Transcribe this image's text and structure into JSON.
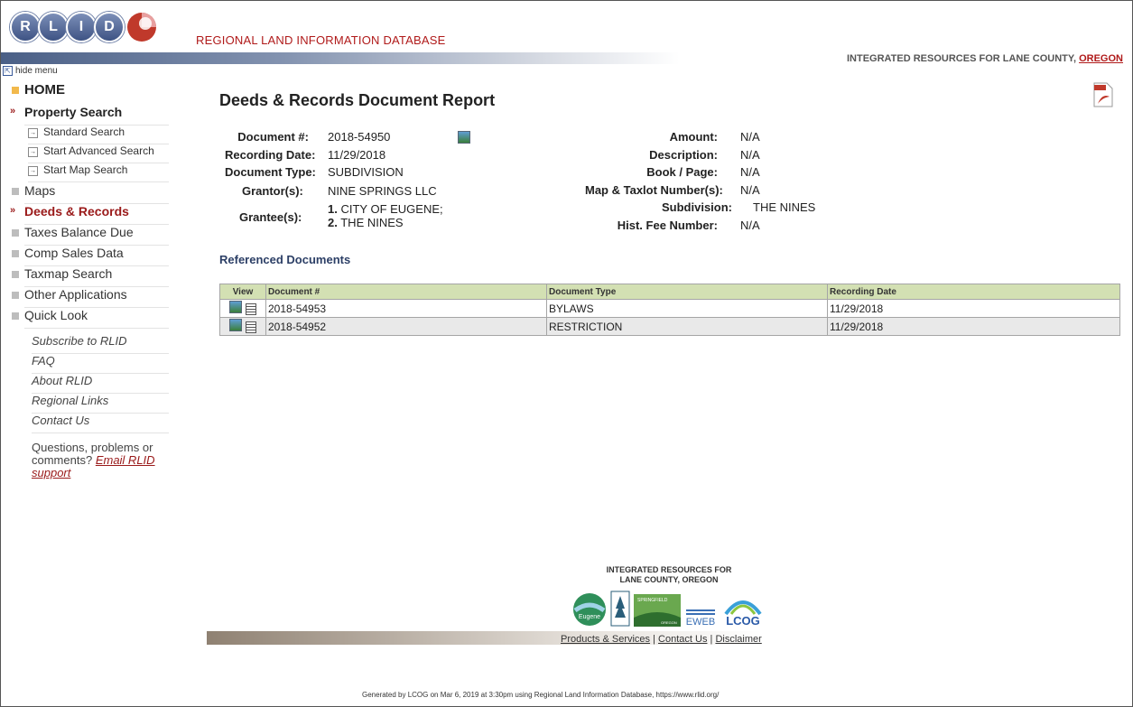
{
  "header": {
    "logo_letters": [
      "R",
      "L",
      "I",
      "D"
    ],
    "site_title": "REGIONAL LAND INFORMATION DATABASE",
    "integrated_prefix": "INTEGRATED RESOURCES FOR LANE COUNTY, ",
    "integrated_link": "OREGON"
  },
  "sidebar": {
    "hide_menu": "hide menu",
    "home": "HOME",
    "property_search": "Property Search",
    "subitems": [
      "Standard Search",
      "Start Advanced Search",
      "Start Map Search"
    ],
    "maps": "Maps",
    "deeds": "Deeds & Records",
    "taxes": "Taxes Balance Due",
    "comp_sales": "Comp Sales Data",
    "taxmap": "Taxmap Search",
    "other_apps": "Other Applications",
    "quick_look": "Quick Look",
    "links": [
      "Subscribe to RLID",
      "FAQ",
      "About RLID",
      "Regional Links",
      "Contact Us"
    ],
    "questions_text": "Questions, problems or comments? ",
    "questions_link": "Email RLID support"
  },
  "report": {
    "title": "Deeds & Records Document Report",
    "left": {
      "document_label": "Document #:",
      "document_value": "2018-54950",
      "recording_date_label": "Recording Date:",
      "recording_date_value": "11/29/2018",
      "doc_type_label": "Document Type:",
      "doc_type_value": "SUBDIVISION",
      "grantor_label": "Grantor(s):",
      "grantor_value": "NINE SPRINGS LLC",
      "grantee_label": "Grantee(s):",
      "grantee_1_num": "1.",
      "grantee_1": "CITY OF EUGENE;",
      "grantee_2_num": "2.",
      "grantee_2": "THE NINES"
    },
    "right": {
      "amount_label": "Amount:",
      "amount_value": "N/A",
      "description_label": "Description:",
      "description_value": "N/A",
      "book_label": "Book / Page:",
      "book_value": "N/A",
      "map_label": "Map & Taxlot Number(s):",
      "map_value": "N/A",
      "subdivision_label": "Subdivision:",
      "subdivision_value": "THE NINES",
      "hist_label": "Hist. Fee Number:",
      "hist_value": "N/A"
    }
  },
  "referenced": {
    "title": "Referenced Documents",
    "columns": [
      "View",
      "Document #",
      "Document Type",
      "Recording Date"
    ],
    "rows": [
      {
        "doc": "2018-54953",
        "type": "BYLAWS",
        "date": "11/29/2018"
      },
      {
        "doc": "2018-54952",
        "type": "RESTRICTION",
        "date": "11/29/2018"
      }
    ]
  },
  "footer": {
    "title_line1": "INTEGRATED RESOURCES FOR",
    "title_line2": "LANE COUNTY, OREGON",
    "logo_texts": [
      "Eugene",
      "SPRINGFIELD",
      "OREGON",
      "EWEB",
      "LCOG"
    ],
    "links": [
      "Products & Services",
      "Contact Us",
      "Disclaimer"
    ],
    "separator": "|",
    "generated": "Generated by LCOG on Mar 6, 2019 at 3:30pm using Regional Land Information Database, https://www.rlid.org/"
  },
  "colors": {
    "brand_red": "#b01a1a",
    "nav_red": "#9a1a1a",
    "table_header": "#d3e0b3",
    "heading_blue": "#2c3f66"
  }
}
